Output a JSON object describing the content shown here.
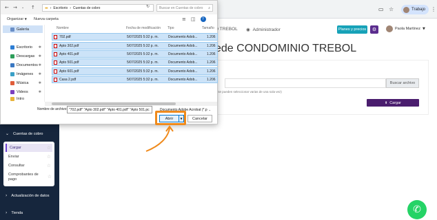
{
  "browser": {
    "profile_label": "Trabajo"
  },
  "sidebar": {
    "section_cuentas": "Cuentas de cobro",
    "submenu": [
      "Cargar",
      "Enviar",
      "Consultar",
      "Comprobantes de pago"
    ],
    "section_actualizacion": "Actualización de datos",
    "section_tienda": "Tienda"
  },
  "main": {
    "nav_frag": "O TREBOL",
    "admin_label": "Administrador",
    "planes_label": "Planes y precios",
    "user_name": "Paola Martínez",
    "title_frag": "ede CONDOMINIO TREBOL",
    "buscar_label": "Buscar archivo",
    "hint_frag": "r (se pueden seleccionar varias de una sola vez)",
    "cargar_label": "Cargar"
  },
  "dialog": {
    "path": [
      "Escritorio",
      "Cuentas de cobro"
    ],
    "search_placeholder": "Buscar en Cuentas de cobro",
    "organize_label": "Organizar",
    "new_folder_label": "Nueva carpeta",
    "nav_items": [
      {
        "label": "Galería",
        "color": "#6a8fc7"
      },
      {
        "label": "Escritorio",
        "color": "#2d7ed4"
      },
      {
        "label": "Descargas",
        "color": "#2d9e5a"
      },
      {
        "label": "Documentos",
        "color": "#3a78c2"
      },
      {
        "label": "Imágenes",
        "color": "#3aa0c7"
      },
      {
        "label": "Música",
        "color": "#e05d3a"
      },
      {
        "label": "Videos",
        "color": "#7b3fbe"
      },
      {
        "label": "Intro",
        "color": "#e8b33a"
      }
    ],
    "columns": {
      "name": "Nombre",
      "date": "Fecha de modificación",
      "type": "Tipo",
      "size": "Tamaño"
    },
    "files": [
      {
        "name": "702.pdf",
        "date": "5/07/2025 5:32 p. m.",
        "type": "Documento Adob...",
        "size": "1.206"
      },
      {
        "name": "Apto 302.pdf",
        "date": "5/07/2025 5:32 p. m.",
        "type": "Documento Adob...",
        "size": "1.206"
      },
      {
        "name": "Apto 401.pdf",
        "date": "5/07/2025 5:32 p. m.",
        "type": "Documento Adob...",
        "size": "1.206"
      },
      {
        "name": "Apto 501.pdf",
        "date": "5/07/2025 5:32 p. m.",
        "type": "Documento Adob...",
        "size": "1.206"
      },
      {
        "name": "Apto 601.pdf",
        "date": "5/07/2025 5:32 p. m.",
        "type": "Documento Adob...",
        "size": "1.206"
      },
      {
        "name": "Casa 2.pdf",
        "date": "5/07/2025 5:32 p. m.",
        "type": "Documento Adob...",
        "size": "1.206"
      }
    ],
    "filename_label": "Nombre de archivo:",
    "filename_value": "\"702.pdf\" \"Apto 302.pdf\" \"Apto 401.pdf\" \"Apto 501.pc",
    "filetype_value": "Documento Adobe Acrobat (*.p",
    "open_label": "Abrir",
    "cancel_label": "Cancelar"
  },
  "colors": {
    "sidebar_bg": "#16263d",
    "accent_purple": "#4a1d6e",
    "highlight_orange": "#ef8a1c",
    "whatsapp_green": "#25d366"
  }
}
